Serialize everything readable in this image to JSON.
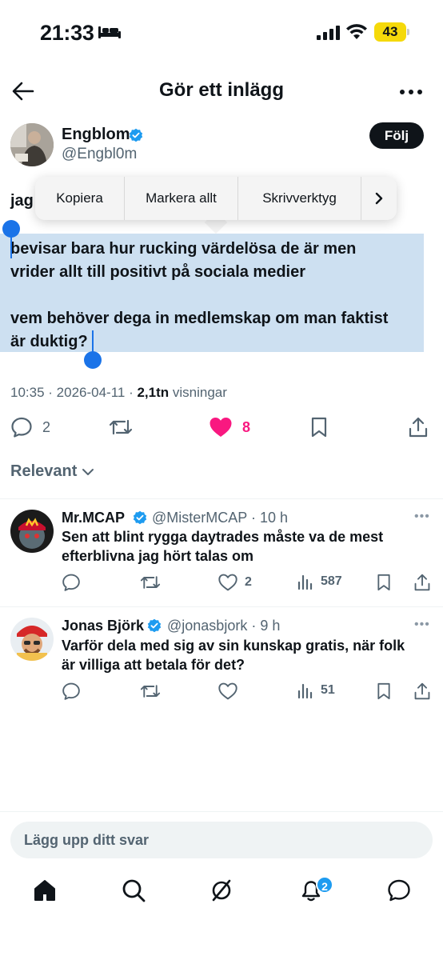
{
  "status_bar": {
    "time": "21:33",
    "battery": "43"
  },
  "header": {
    "title": "Gör ett inlägg"
  },
  "author": {
    "name": "Engblom",
    "handle": "@Engbl0m",
    "follow_label": "Följ"
  },
  "tweet": {
    "first_word": "jag",
    "selected_text": "bevisar bara hur rucking värdelösa de är men\nvrider allt till positivt på sociala medier\n\nvem behöver dega in medlemskap om man faktist\när duktig?",
    "time": "10:35",
    "date": "2026-04-11",
    "views_count": "2,1tn",
    "views_label": "visningar"
  },
  "context_menu": {
    "items": [
      "Kopiera",
      "Markera allt",
      "Skrivverktyg"
    ]
  },
  "actions": {
    "replies": "2",
    "likes": "8"
  },
  "sort": {
    "label": "Relevant"
  },
  "replies": [
    {
      "name": "Mr.MCAP",
      "handle": "@MisterMCAP",
      "time": "10 h",
      "text": "Sen att blint rygga daytrades måste va de mest efterblivna jag hört talas om",
      "likes": "2",
      "views": "587"
    },
    {
      "name": "Jonas Björk",
      "handle": "@jonasbjork",
      "time": "9 h",
      "text": "Varför dela med sig av sin kunskap gratis, när folk är villiga att betala för det?",
      "likes": "",
      "views": "51"
    }
  ],
  "reply_input": {
    "placeholder": "Lägg upp ditt svar"
  },
  "bottom_nav": {
    "notifications_badge": "2"
  },
  "colors": {
    "accent": "#1d9bf0",
    "like": "#f91880",
    "selection": "#cde0f1",
    "handle": "#1a73e8"
  }
}
